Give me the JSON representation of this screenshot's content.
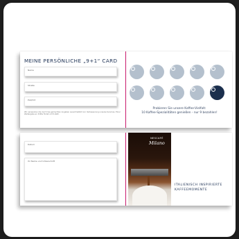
{
  "top_card": {
    "title": "MEINE PERSÖNLICHE „9+1“ CARD",
    "fields": [
      "Name",
      "Straße",
      "PLZ/Ort"
    ],
    "privacy_note": "Wir verwenden die durch Sie gemachten Angaben ausschließlich zur Verbesserung unseres Services. Einer Weitergabe an Dritte findet nicht statt.",
    "stamps_total": 10,
    "stamps_filled_index": 9,
    "promo_line1": "Probieren Sie unsere Kaffee-Vielfalt:",
    "promo_line2": "10 Kaffee-Spezialitäten genießen - nur 9 bezahlen!",
    "colors": {
      "circle": "#b4c0cd",
      "circle_filled": "#1b2f4d",
      "divider": "#c8176a",
      "text": "#1b2f52"
    }
  },
  "bottom_card": {
    "fields": [
      "Datum",
      "Ihr Name und Unterschrift"
    ],
    "brand_top": "NESCAFÉ",
    "brand_bottom": "Milano",
    "tagline_line1": "ITALIENISCH INSPIRIERTE",
    "tagline_line2": "KAFFEEMOMENTE"
  }
}
